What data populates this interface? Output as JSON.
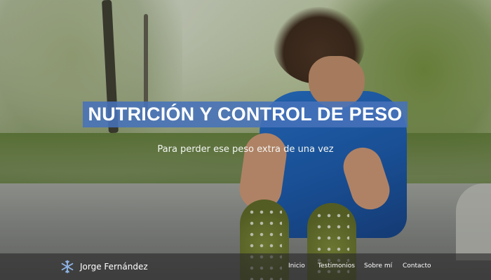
{
  "hero": {
    "title": "NUTRICIÓN Y CONTROL DE PESO",
    "subtitle": "Para perder ese peso extra de una vez",
    "title_bg_color": "#4772ba"
  },
  "navbar": {
    "brand_icon": "snowflake-icon",
    "brand_name": "Jorge Fernández",
    "links": [
      {
        "label": "Inicio"
      },
      {
        "label": "Testimonios"
      },
      {
        "label": "Sobre mí"
      },
      {
        "label": "Contacto"
      }
    ]
  },
  "colors": {
    "accent": "#4772ba",
    "navbar_bg": "#282828",
    "icon": "#8fb4e8"
  }
}
